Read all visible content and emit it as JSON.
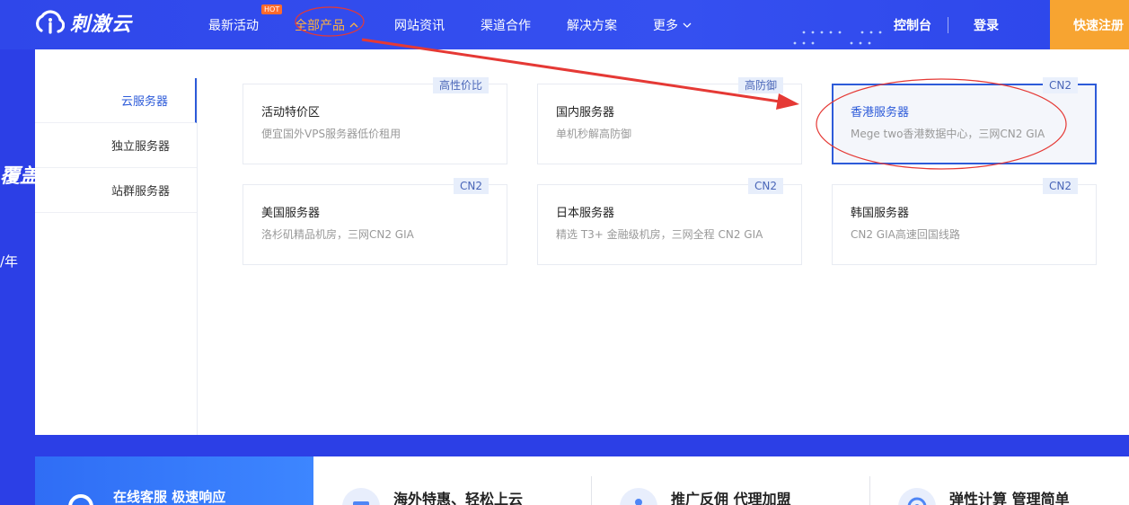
{
  "brand": {
    "name": "刺激云"
  },
  "nav": {
    "items": [
      {
        "label": "最新活动",
        "badge": "HOT"
      },
      {
        "label": "全部产品",
        "active": true
      },
      {
        "label": "网站资讯"
      },
      {
        "label": "渠道合作"
      },
      {
        "label": "解决方案"
      },
      {
        "label": "更多"
      }
    ],
    "console": "控制台",
    "login": "登录",
    "register": "快速注册"
  },
  "hero": {
    "peek_title": "覆盖",
    "peek_price": "/年"
  },
  "dropdown": {
    "side_items": [
      {
        "label": "云服务器",
        "active": true
      },
      {
        "label": "独立服务器"
      },
      {
        "label": "站群服务器"
      }
    ],
    "cards": [
      {
        "title": "活动特价区",
        "desc": "便宜国外VPS服务器低价租用",
        "tag": "高性价比"
      },
      {
        "title": "国内服务器",
        "desc": "单机秒解高防御",
        "tag": "高防御"
      },
      {
        "title": "香港服务器",
        "desc": "Mege two香港数据中心，三网CN2 GIA",
        "tag": "CN2",
        "highlight": true
      },
      {
        "title": "美国服务器",
        "desc": "洛杉矶精品机房，三网CN2 GIA",
        "tag": "CN2"
      },
      {
        "title": "日本服务器",
        "desc": "精选 T3+ 金融级机房，三网全程 CN2 GIA",
        "tag": "CN2"
      },
      {
        "title": "韩国服务器",
        "desc": "CN2 GIA高速回国线路",
        "tag": "CN2"
      }
    ]
  },
  "bottom": {
    "service": "在线客服 极速响应",
    "features": [
      "海外特惠、轻松上云",
      "推广反佣 代理加盟",
      "弹性计算 管理简单"
    ]
  },
  "colors": {
    "primary": "#2c3fe6",
    "accent_orange": "#f7a431",
    "active_nav": "#ffb23f",
    "link_blue": "#2d5bd9",
    "annotation_red": "#e53935"
  }
}
